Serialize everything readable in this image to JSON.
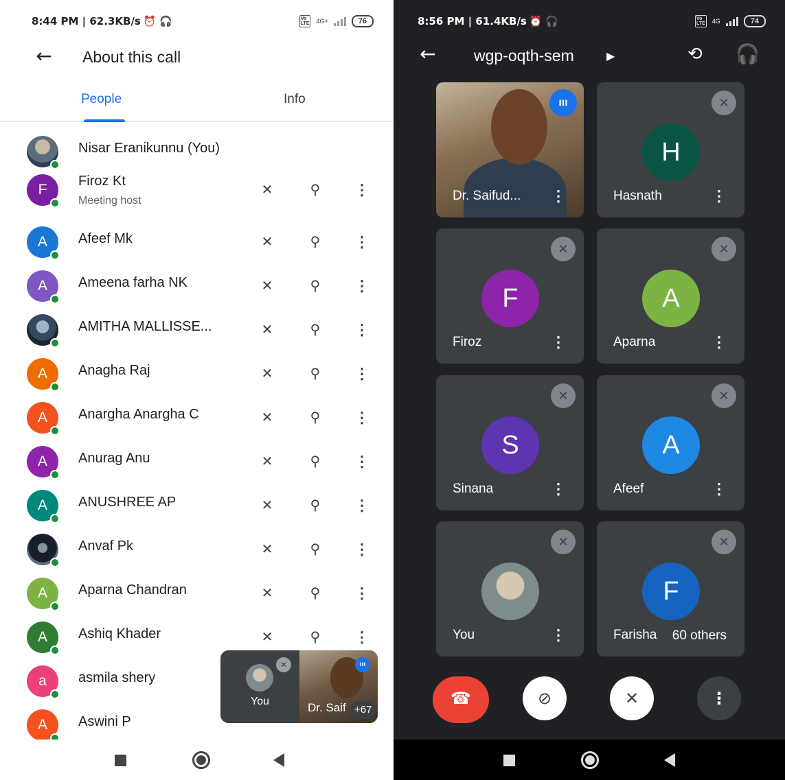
{
  "left": {
    "status": {
      "time": "8:44 PM | 62.3KB/s",
      "icons": "⏰ 🎧",
      "network": "4G+",
      "battery": "76"
    },
    "title": "About this call",
    "tabs": [
      "People",
      "Info"
    ],
    "people": [
      {
        "name": "Nisar Eranikunnu (You)",
        "initial": "",
        "color": "",
        "photo": "photo",
        "subtitle": "",
        "actions": false
      },
      {
        "name": "Firoz Kt",
        "initial": "F",
        "color": "#7b1fa2",
        "subtitle": "Meeting host",
        "actions": true
      },
      {
        "name": "Afeef Mk",
        "initial": "A",
        "color": "#1976d2",
        "subtitle": "",
        "actions": true
      },
      {
        "name": "Ameena farha NK",
        "initial": "A",
        "color": "#7e57c2",
        "subtitle": "",
        "actions": true
      },
      {
        "name": "AMITHA MALLISSE...",
        "initial": "",
        "color": "",
        "photo": "photo2",
        "subtitle": "",
        "actions": true
      },
      {
        "name": "Anagha Raj",
        "initial": "A",
        "color": "#ef6c00",
        "subtitle": "",
        "actions": true
      },
      {
        "name": "Anargha Anargha C",
        "initial": "A",
        "color": "#f4511e",
        "subtitle": "",
        "actions": true
      },
      {
        "name": "Anurag Anu",
        "initial": "A",
        "color": "#8e24aa",
        "subtitle": "",
        "actions": true
      },
      {
        "name": "ANUSHREE AP",
        "initial": "A",
        "color": "#00897b",
        "subtitle": "",
        "actions": true
      },
      {
        "name": "Anvaf Pk",
        "initial": "",
        "color": "",
        "photo": "photo3",
        "subtitle": "",
        "actions": true
      },
      {
        "name": "Aparna Chandran",
        "initial": "A",
        "color": "#7cb342",
        "subtitle": "",
        "actions": true
      },
      {
        "name": "Ashiq Khader",
        "initial": "A",
        "color": "#2e7d32",
        "subtitle": "",
        "actions": true
      },
      {
        "name": "asmila shery",
        "initial": "a",
        "color": "#ec407a",
        "subtitle": "",
        "actions": true
      },
      {
        "name": "Aswini P",
        "initial": "A",
        "color": "#f4511e",
        "subtitle": "",
        "actions": true
      }
    ],
    "icons": {
      "mute": "mic-off-icon",
      "pin": "pin-icon",
      "more": "more-vert-icon"
    },
    "pip": {
      "you_label": "You",
      "speaker_name": "Dr. Saif",
      "count": "+67"
    }
  },
  "right": {
    "status": {
      "time": "8:56 PM | 61.4KB/s",
      "icons": "⏰ 🎧",
      "network": "4G",
      "battery": "74"
    },
    "title": "wgp-oqth-sem",
    "tiles": [
      {
        "name": "Dr. Saifud...",
        "kind": "video",
        "initial": "",
        "color": ""
      },
      {
        "name": "Hasnath",
        "kind": "avatar",
        "initial": "H",
        "color": "#0b5345"
      },
      {
        "name": "Firoz",
        "kind": "avatar",
        "initial": "F",
        "color": "#8e24aa"
      },
      {
        "name": "Aparna",
        "kind": "avatar",
        "initial": "A",
        "color": "#7cb342"
      },
      {
        "name": "Sinana",
        "kind": "avatar",
        "initial": "S",
        "color": "#5e35b1"
      },
      {
        "name": "Afeef",
        "kind": "avatar",
        "initial": "A",
        "color": "#1e88e5"
      },
      {
        "name": "You",
        "kind": "photo",
        "initial": "",
        "color": ""
      },
      {
        "name": "Farisha",
        "kind": "avatar",
        "initial": "F",
        "color": "#1565c0"
      }
    ],
    "others_label": "60 others",
    "accent": "#1a73e8",
    "end_call_color": "#ea4335"
  }
}
